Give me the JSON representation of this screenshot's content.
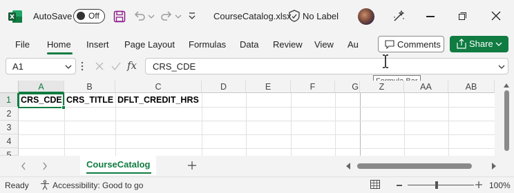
{
  "titlebar": {
    "autosave_label": "AutoSave",
    "autosave_state": "Off",
    "document_title": "CourseCatalog.xlsx",
    "sensitivity_label": "No Label",
    "icons": [
      "excel-logo-icon",
      "save-icon",
      "undo-icon",
      "redo-icon",
      "customize-icon",
      "shield-icon",
      "copilot-icon",
      "minimize-icon",
      "maximize-icon",
      "close-icon"
    ]
  },
  "ribbon": {
    "tabs": [
      {
        "label": "File"
      },
      {
        "label": "Home"
      },
      {
        "label": "Insert"
      },
      {
        "label": "Page Layout"
      },
      {
        "label": "Formulas"
      },
      {
        "label": "Data"
      },
      {
        "label": "Review"
      },
      {
        "label": "View"
      },
      {
        "label": "Au"
      }
    ],
    "active_tab": "Home",
    "comments_label": "Comments",
    "share_label": "Share",
    "accent_color": "#107c41"
  },
  "formula_bar": {
    "name_box": "A1",
    "formula": "CRS_CDE",
    "fx_symbol": "fx",
    "tooltip": "Formula Bar"
  },
  "grid": {
    "columns": [
      "A",
      "B",
      "C",
      "D",
      "E",
      "F",
      "G",
      "Z",
      "AA",
      "AB"
    ],
    "selected_column": "A",
    "rows": [
      "1",
      "2",
      "3",
      "4",
      "5"
    ],
    "selected_row": "1",
    "cells": {
      "A1": "CRS_CDE",
      "B1": "CRS_TITLE",
      "C1": "DFLT_CREDIT_HRS"
    }
  },
  "sheets": {
    "tabs": [
      {
        "label": "CourseCatalog"
      }
    ],
    "active": "CourseCatalog"
  },
  "statusbar": {
    "ready": "Ready",
    "accessibility": "Accessibility: Good to go",
    "zoom": "100%"
  }
}
